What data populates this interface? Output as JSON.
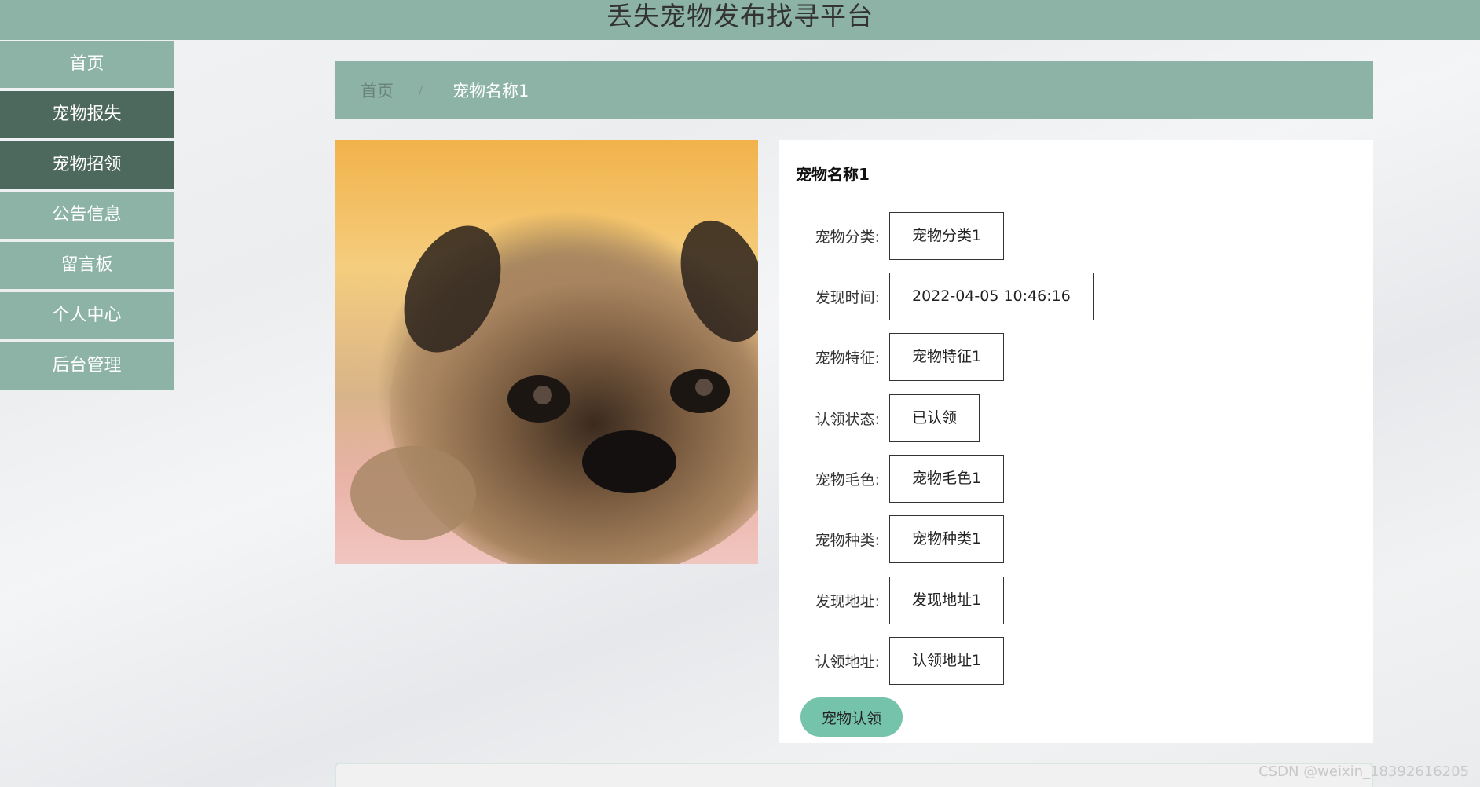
{
  "header": {
    "title": "丢失宠物发布找寻平台"
  },
  "sidebar": {
    "items": [
      {
        "label": "首页"
      },
      {
        "label": "宠物报失"
      },
      {
        "label": "宠物招领"
      },
      {
        "label": "公告信息"
      },
      {
        "label": "留言板"
      },
      {
        "label": "个人中心"
      },
      {
        "label": "后台管理"
      }
    ]
  },
  "breadcrumb": {
    "home": "首页",
    "separator": "/",
    "current": "宠物名称1"
  },
  "pet_image": {
    "icon": "pug-photo"
  },
  "detail": {
    "name": "宠物名称1",
    "fields": [
      {
        "label": "宠物分类:",
        "value": "宠物分类1"
      },
      {
        "label": "发现时间:",
        "value": "2022-04-05 10:46:16"
      },
      {
        "label": "宠物特征:",
        "value": "宠物特征1"
      },
      {
        "label": "认领状态:",
        "value": "已认领"
      },
      {
        "label": "宠物毛色:",
        "value": "宠物毛色1"
      },
      {
        "label": "宠物种类:",
        "value": "宠物种类1"
      },
      {
        "label": "发现地址:",
        "value": "发现地址1"
      },
      {
        "label": "认领地址:",
        "value": "认领地址1"
      }
    ],
    "claim_button": "宠物认领"
  },
  "watermark": "CSDN @weixin_18392616205",
  "colors": {
    "theme": "#8cb3a6",
    "active": "#4d685d",
    "button": "#76c3ac"
  }
}
